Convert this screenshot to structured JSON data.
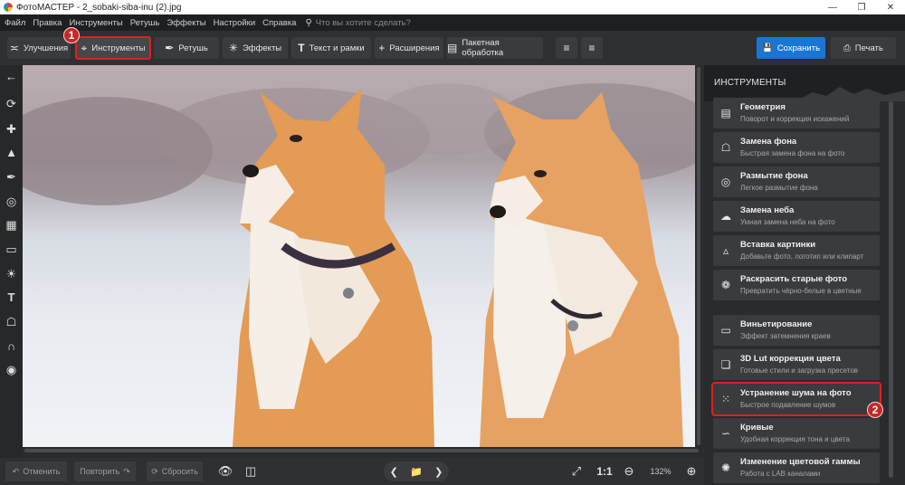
{
  "window": {
    "title": "ФотоМАСТЕР - 2_sobaki-siba-inu (2).jpg",
    "controls": [
      "—",
      "❐",
      "✕"
    ]
  },
  "menu": {
    "items": [
      "Файл",
      "Правка",
      "Инструменты",
      "Ретушь",
      "Эффекты",
      "Настройки",
      "Справка"
    ],
    "search_placeholder": "Что вы хотите сделать?"
  },
  "toolbar": {
    "tabs": [
      {
        "label": "Улучшения",
        "icon": "enhance-icon"
      },
      {
        "label": "Инструменты",
        "icon": "crop-icon",
        "active": true
      },
      {
        "label": "Ретушь",
        "icon": "brush-icon"
      },
      {
        "label": "Эффекты",
        "icon": "sparkle-icon"
      },
      {
        "label": "Текст и рамки",
        "icon": "text-icon"
      },
      {
        "label": "Расширения",
        "icon": "plus-icon"
      },
      {
        "label": "Пакетная обработка",
        "icon": "batch-icon"
      }
    ],
    "save_label": "Сохранить",
    "print_label": "Печать"
  },
  "annotations": {
    "badge1": "1",
    "badge2": "2",
    "color": "#e02020"
  },
  "bottom": {
    "undo_label": "Отменить",
    "redo_label": "Повторить",
    "reset_label": "Сбросить",
    "ratio_label": "1:1",
    "zoom_value": "132%"
  },
  "panel": {
    "title": "ИНСТРУМЕНТЫ",
    "tools": [
      {
        "title": "Геометрия",
        "desc": "Поворот и коррекция искажений",
        "icon": "geometry-icon"
      },
      {
        "title": "Замена фона",
        "desc": "Быстрая замена фона на фото",
        "icon": "bucket-icon"
      },
      {
        "title": "Размытие фона",
        "desc": "Легкое размытие фона",
        "icon": "blur-icon"
      },
      {
        "title": "Замена неба",
        "desc": "Умная замена неба на фото",
        "icon": "cloud-icon"
      },
      {
        "title": "Вставка картинки",
        "desc": "Добавьте фото, логотип или клипарт",
        "icon": "image-insert-icon"
      },
      {
        "title": "Раскрасить старые фото",
        "desc": "Превратить чёрно-белые в цветные",
        "icon": "palette-icon"
      },
      {
        "title": "Виньетирование",
        "desc": "Эффект затемнения краев",
        "icon": "vignette-icon"
      },
      {
        "title": "3D Lut   коррекция цвета",
        "desc": "Готовые стили и загрузка пресетов",
        "icon": "cube-icon"
      },
      {
        "title": "Устранение шума на фото",
        "desc": "Быстрое подавление шумов",
        "icon": "noise-icon",
        "highlighted": true
      },
      {
        "title": "Кривые",
        "desc": "Удобная коррекция тона и цвета",
        "icon": "curves-icon"
      },
      {
        "title": "Изменение цветовой гаммы",
        "desc": "Работа с LAB каналами",
        "icon": "color-gamma-icon"
      }
    ]
  },
  "colors": {
    "accent": "#1976d2",
    "panel_bg": "#2a2b2d",
    "toolbar_bg": "#2f3033",
    "highlight": "#e02020"
  }
}
